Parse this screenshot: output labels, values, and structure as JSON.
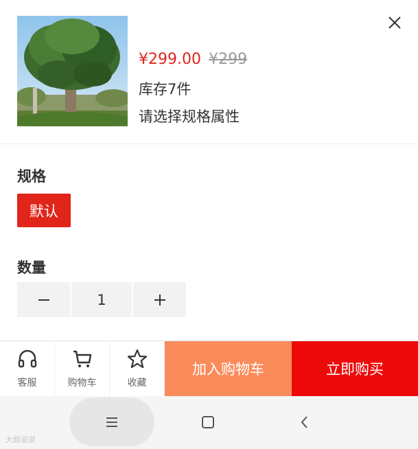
{
  "product": {
    "price": "¥299.00",
    "original_price": "¥299",
    "stock_text": "库存7件",
    "select_hint": "请选择规格属性"
  },
  "spec": {
    "title": "规格",
    "options": [
      {
        "label": "默认",
        "selected": true
      }
    ]
  },
  "quantity": {
    "title": "数量",
    "value": "1",
    "minus": "−",
    "plus": "+"
  },
  "action_bar": {
    "service_label": "客服",
    "cart_label": "购物车",
    "favorite_label": "收藏",
    "add_to_cart_label": "加入购物车",
    "buy_now_label": "立即购买"
  },
  "nav_bar": {
    "menu_icon": "menu-icon",
    "home_icon": "square-home-icon",
    "back_icon": "back-chevron-icon"
  },
  "colors": {
    "accent_red": "#e1251b",
    "buy_now": "#ee0a0a",
    "add_to_cart": "#fa8c5c"
  },
  "watermark": "大颜说说"
}
